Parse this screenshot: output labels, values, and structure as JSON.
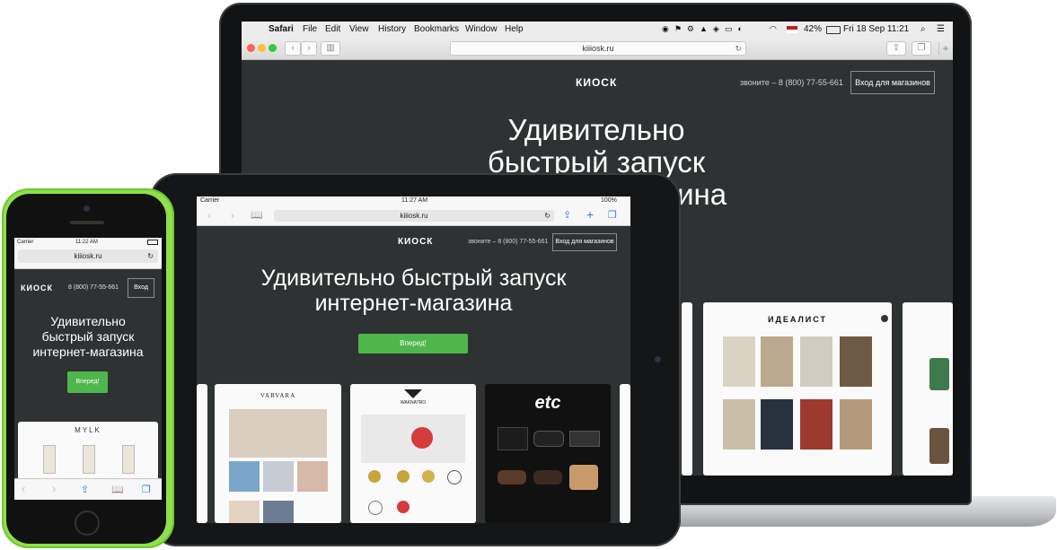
{
  "mac": {
    "menu": {
      "apple": "",
      "items": [
        "Safari",
        "File",
        "Edit",
        "View",
        "History",
        "Bookmarks",
        "Window",
        "Help"
      ],
      "battery": "42%",
      "datetime": "Fri 18 Sep  11:21"
    },
    "browser": {
      "url": "kiiiosk.ru",
      "new_tab": "+"
    },
    "site": {
      "logo": "КИОСК",
      "phone": "звоните – 8 (800) 77-55-661",
      "login": "Вход для магазинов",
      "hero_lines": [
        "Удивительно",
        "быстрый запуск",
        "интернет-магазина"
      ],
      "store_title": "ИДЕАЛИСТ"
    }
  },
  "ipad": {
    "status": {
      "carrier": "Carrier",
      "time": "11:27 AM",
      "battery": "100%"
    },
    "url": "kiiiosk.ru",
    "site": {
      "logo": "КИОСК",
      "phone": "звоните – 8 (800) 77-55-661",
      "login": "Вход для магазинов",
      "hero_lines": [
        "Удивительно быстрый запуск",
        "интернет-магазина"
      ],
      "cta": "Вперед!",
      "stores": [
        "VARVARA",
        "WAKNATRO",
        "etc"
      ]
    }
  },
  "iphone": {
    "status": {
      "carrier": "Carrier",
      "time": "11:22 AM"
    },
    "url": "kiiiosk.ru",
    "site": {
      "logo": "КИОСК",
      "phone": "8 (800) 77-55-661",
      "login": "Вход",
      "hero_lines": [
        "Удивительно",
        "быстрый запуск",
        "интернет-магазина"
      ],
      "cta": "Вперед!",
      "store_title": "MYLK"
    }
  },
  "colors": {
    "site_bg": "#2f3233",
    "accent_green": "#4eb64a",
    "iphone_body": "#8ee04d",
    "ios_blue": "#2f7cf6"
  }
}
